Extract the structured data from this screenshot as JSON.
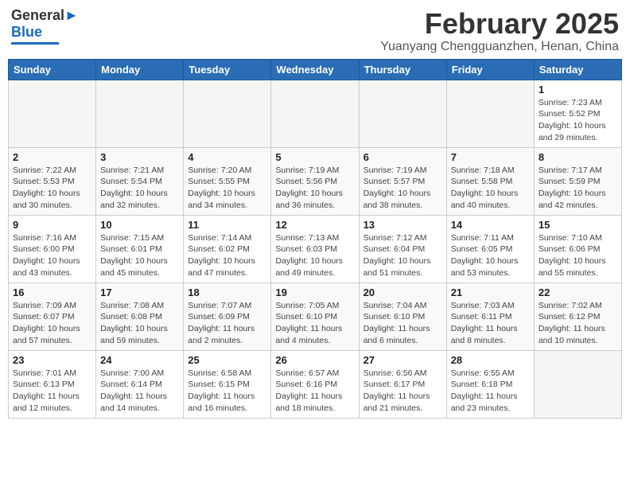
{
  "header": {
    "logo_general": "General",
    "logo_blue": "Blue",
    "month_title": "February 2025",
    "subtitle": "Yuanyang Chengguanzhen, Henan, China"
  },
  "days_of_week": [
    "Sunday",
    "Monday",
    "Tuesday",
    "Wednesday",
    "Thursday",
    "Friday",
    "Saturday"
  ],
  "weeks": [
    [
      {
        "day": "",
        "info": ""
      },
      {
        "day": "",
        "info": ""
      },
      {
        "day": "",
        "info": ""
      },
      {
        "day": "",
        "info": ""
      },
      {
        "day": "",
        "info": ""
      },
      {
        "day": "",
        "info": ""
      },
      {
        "day": "1",
        "info": "Sunrise: 7:23 AM\nSunset: 5:52 PM\nDaylight: 10 hours and 29 minutes."
      }
    ],
    [
      {
        "day": "2",
        "info": "Sunrise: 7:22 AM\nSunset: 5:53 PM\nDaylight: 10 hours and 30 minutes."
      },
      {
        "day": "3",
        "info": "Sunrise: 7:21 AM\nSunset: 5:54 PM\nDaylight: 10 hours and 32 minutes."
      },
      {
        "day": "4",
        "info": "Sunrise: 7:20 AM\nSunset: 5:55 PM\nDaylight: 10 hours and 34 minutes."
      },
      {
        "day": "5",
        "info": "Sunrise: 7:19 AM\nSunset: 5:56 PM\nDaylight: 10 hours and 36 minutes."
      },
      {
        "day": "6",
        "info": "Sunrise: 7:19 AM\nSunset: 5:57 PM\nDaylight: 10 hours and 38 minutes."
      },
      {
        "day": "7",
        "info": "Sunrise: 7:18 AM\nSunset: 5:58 PM\nDaylight: 10 hours and 40 minutes."
      },
      {
        "day": "8",
        "info": "Sunrise: 7:17 AM\nSunset: 5:59 PM\nDaylight: 10 hours and 42 minutes."
      }
    ],
    [
      {
        "day": "9",
        "info": "Sunrise: 7:16 AM\nSunset: 6:00 PM\nDaylight: 10 hours and 43 minutes."
      },
      {
        "day": "10",
        "info": "Sunrise: 7:15 AM\nSunset: 6:01 PM\nDaylight: 10 hours and 45 minutes."
      },
      {
        "day": "11",
        "info": "Sunrise: 7:14 AM\nSunset: 6:02 PM\nDaylight: 10 hours and 47 minutes."
      },
      {
        "day": "12",
        "info": "Sunrise: 7:13 AM\nSunset: 6:03 PM\nDaylight: 10 hours and 49 minutes."
      },
      {
        "day": "13",
        "info": "Sunrise: 7:12 AM\nSunset: 6:04 PM\nDaylight: 10 hours and 51 minutes."
      },
      {
        "day": "14",
        "info": "Sunrise: 7:11 AM\nSunset: 6:05 PM\nDaylight: 10 hours and 53 minutes."
      },
      {
        "day": "15",
        "info": "Sunrise: 7:10 AM\nSunset: 6:06 PM\nDaylight: 10 hours and 55 minutes."
      }
    ],
    [
      {
        "day": "16",
        "info": "Sunrise: 7:09 AM\nSunset: 6:07 PM\nDaylight: 10 hours and 57 minutes."
      },
      {
        "day": "17",
        "info": "Sunrise: 7:08 AM\nSunset: 6:08 PM\nDaylight: 10 hours and 59 minutes."
      },
      {
        "day": "18",
        "info": "Sunrise: 7:07 AM\nSunset: 6:09 PM\nDaylight: 11 hours and 2 minutes."
      },
      {
        "day": "19",
        "info": "Sunrise: 7:05 AM\nSunset: 6:10 PM\nDaylight: 11 hours and 4 minutes."
      },
      {
        "day": "20",
        "info": "Sunrise: 7:04 AM\nSunset: 6:10 PM\nDaylight: 11 hours and 6 minutes."
      },
      {
        "day": "21",
        "info": "Sunrise: 7:03 AM\nSunset: 6:11 PM\nDaylight: 11 hours and 8 minutes."
      },
      {
        "day": "22",
        "info": "Sunrise: 7:02 AM\nSunset: 6:12 PM\nDaylight: 11 hours and 10 minutes."
      }
    ],
    [
      {
        "day": "23",
        "info": "Sunrise: 7:01 AM\nSunset: 6:13 PM\nDaylight: 11 hours and 12 minutes."
      },
      {
        "day": "24",
        "info": "Sunrise: 7:00 AM\nSunset: 6:14 PM\nDaylight: 11 hours and 14 minutes."
      },
      {
        "day": "25",
        "info": "Sunrise: 6:58 AM\nSunset: 6:15 PM\nDaylight: 11 hours and 16 minutes."
      },
      {
        "day": "26",
        "info": "Sunrise: 6:57 AM\nSunset: 6:16 PM\nDaylight: 11 hours and 18 minutes."
      },
      {
        "day": "27",
        "info": "Sunrise: 6:56 AM\nSunset: 6:17 PM\nDaylight: 11 hours and 21 minutes."
      },
      {
        "day": "28",
        "info": "Sunrise: 6:55 AM\nSunset: 6:18 PM\nDaylight: 11 hours and 23 minutes."
      },
      {
        "day": "",
        "info": ""
      }
    ]
  ]
}
